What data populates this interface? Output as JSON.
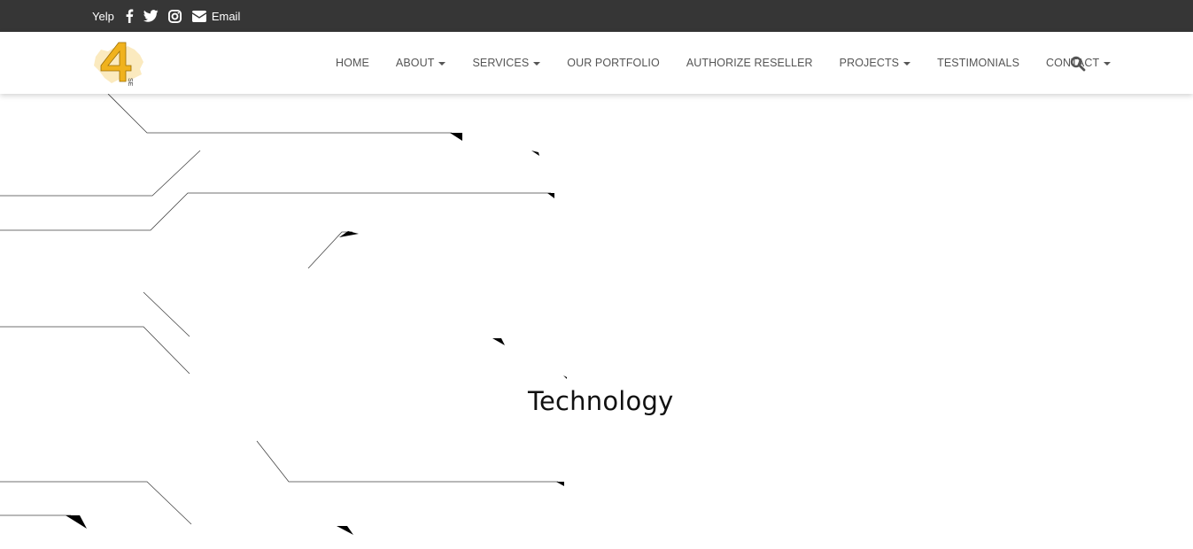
{
  "topbar": {
    "background_color": "#363636",
    "links": [
      {
        "label": "Yelp",
        "icon": "yelp-text"
      },
      {
        "label": "",
        "icon": "facebook-icon"
      },
      {
        "label": "",
        "icon": "twitter-icon"
      },
      {
        "label": "",
        "icon": "instagram-icon"
      },
      {
        "label": "Email",
        "icon": "envelope-icon"
      }
    ]
  },
  "navbar": {
    "logo_brand_text": "4 SERV",
    "logo_color": "#f0b21d",
    "menu": [
      {
        "label": "HOME",
        "dropdown": false
      },
      {
        "label": "ABOUT",
        "dropdown": true
      },
      {
        "label": "SERVICES",
        "dropdown": true
      },
      {
        "label": "OUR PORTFOLIO",
        "dropdown": false
      },
      {
        "label": "AUTHORIZE RESELLER",
        "dropdown": false
      },
      {
        "label": "PROJECTS",
        "dropdown": true
      },
      {
        "label": "TESTIMONIALS",
        "dropdown": false
      },
      {
        "label": "CONTACT",
        "dropdown": true
      }
    ],
    "search_icon": "search-icon",
    "text_color": "#555555"
  },
  "hero": {
    "title": "Technology"
  }
}
